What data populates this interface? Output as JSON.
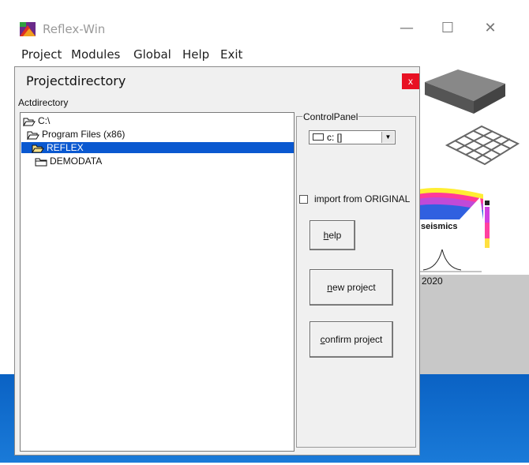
{
  "app": {
    "title": "Reflex-Win",
    "minimize_glyph": "—",
    "maximize_glyph": "☐",
    "close_glyph": "✕"
  },
  "menu": {
    "items": [
      "Project",
      "Modules",
      "Global",
      "Help",
      "Exit"
    ]
  },
  "background": {
    "seismics_label": "seismics",
    "year_label": "2020"
  },
  "dialog": {
    "title": "Projectdirectory",
    "close_glyph": "x",
    "actdirectory_label": "Actdirectory",
    "tree": [
      {
        "label": "C:\\",
        "selected": false
      },
      {
        "label": "Program Files (x86)",
        "selected": false
      },
      {
        "label": "REFLEX",
        "selected": true
      },
      {
        "label": "DEMODATA",
        "selected": false
      }
    ],
    "control_panel": {
      "legend": "ControlPanel",
      "drive_value": "c: []",
      "import_label": "import from ORIGINAL",
      "import_checked": false,
      "help_button": "help",
      "new_project_button": "new project",
      "confirm_project_button": "confirm project"
    }
  },
  "colors": {
    "selection": "#0a58d0",
    "close_red": "#e81123",
    "taskbar_blue": "#0a62c4"
  }
}
